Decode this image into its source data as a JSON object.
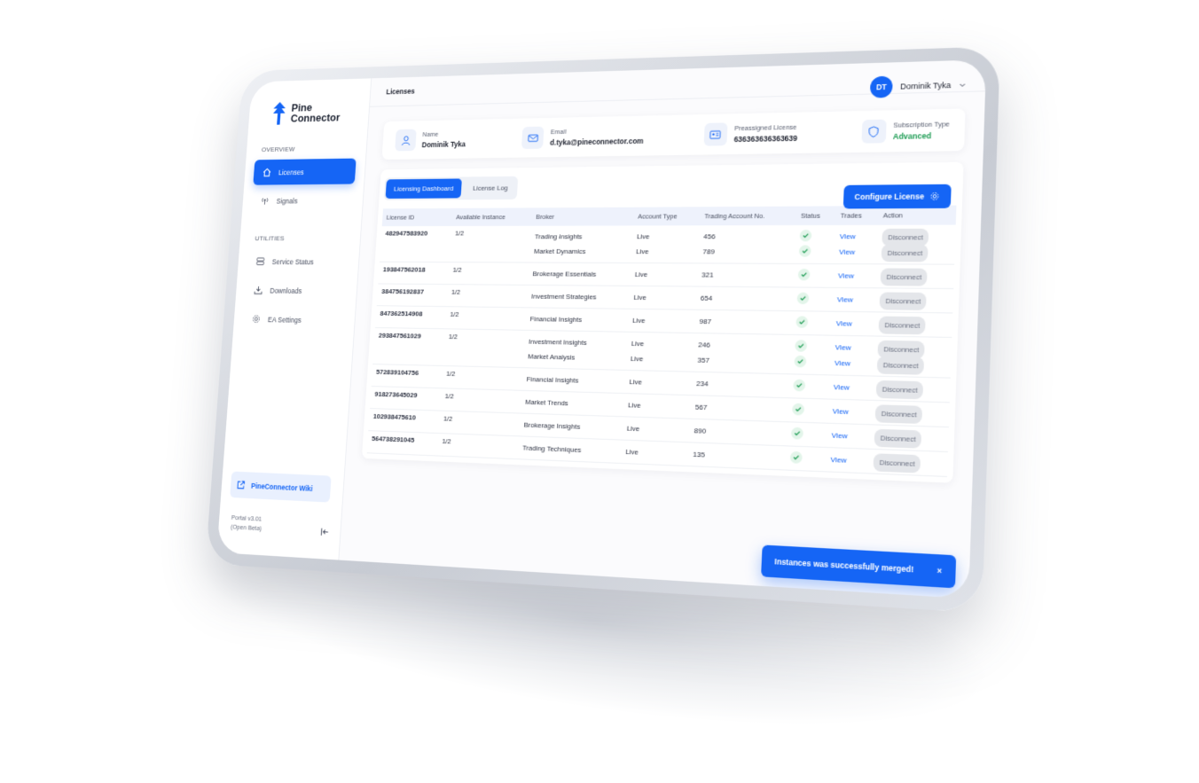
{
  "app": {
    "logo_line1": "Pine",
    "logo_line2": "Connector",
    "breadcrumb": "Licenses"
  },
  "sidebar": {
    "overview_label": "OVERVIEW",
    "utilities_label": "UTILITIES",
    "items": [
      {
        "label": "Licenses",
        "icon": "home-icon"
      },
      {
        "label": "Signals",
        "icon": "signal-icon"
      },
      {
        "label": "Service Status",
        "icon": "server-icon"
      },
      {
        "label": "Downloads",
        "icon": "download-icon"
      },
      {
        "label": "EA Settings",
        "icon": "gear-icon"
      }
    ],
    "wiki": "PineConnector Wiki",
    "version_line1": "Portal v3.01",
    "version_line2": "(Open Beta)"
  },
  "user": {
    "initials": "DT",
    "name": "Dominik Tyka"
  },
  "info": {
    "name_label": "Name",
    "name_value": "Dominik Tyka",
    "email_label": "Email",
    "email_value": "d.tyka@pineconnector.com",
    "license_label": "Preassigned License",
    "license_value": "636363636363639",
    "sub_label": "Subscription Type",
    "sub_value": "Advanced"
  },
  "tabs": {
    "dashboard": "Licensing Dashboard",
    "log": "License Log"
  },
  "configure_label": "Configure License",
  "table": {
    "headers": {
      "license_id": "License ID",
      "available": "Available Instance",
      "broker": "Broker",
      "account_type": "Account  Type",
      "account_no": "Trading  Account No.",
      "status": "Status",
      "trades": "Trades",
      "action": "Action"
    },
    "view_label": "View",
    "disconnect_label": "Disconnect",
    "rows": [
      {
        "id": "482947583920",
        "avail": "1/2",
        "sub": [
          {
            "broker": "Trading Insights",
            "type": "Live",
            "acc": "456"
          },
          {
            "broker": "Market Dynamics",
            "type": "Live",
            "acc": "789"
          }
        ]
      },
      {
        "id": "193847562018",
        "avail": "1/2",
        "sub": [
          {
            "broker": "Brokerage Essentials",
            "type": "Live",
            "acc": "321"
          }
        ]
      },
      {
        "id": "384756192837",
        "avail": "1/2",
        "sub": [
          {
            "broker": "Investment Strategies",
            "type": "Live",
            "acc": "654"
          }
        ]
      },
      {
        "id": "847362514908",
        "avail": "1/2",
        "sub": [
          {
            "broker": "Financial Insights",
            "type": "Live",
            "acc": "987"
          }
        ]
      },
      {
        "id": "293847561029",
        "avail": "1/2",
        "sub": [
          {
            "broker": "Investment Insights",
            "type": "Live",
            "acc": "246"
          },
          {
            "broker": "Market Analysis",
            "type": "Live",
            "acc": "357"
          }
        ]
      },
      {
        "id": "572839104756",
        "avail": "1/2",
        "sub": [
          {
            "broker": "Financial Insights",
            "type": "Live",
            "acc": "234"
          }
        ]
      },
      {
        "id": "918273645029",
        "avail": "1/2",
        "sub": [
          {
            "broker": "Market Trends",
            "type": "Live",
            "acc": "567"
          }
        ]
      },
      {
        "id": "102938475610",
        "avail": "1/2",
        "sub": [
          {
            "broker": "Brokerage Insights",
            "type": "Live",
            "acc": "890"
          }
        ]
      },
      {
        "id": "564738291045",
        "avail": "1/2",
        "sub": [
          {
            "broker": "Trading Techniques",
            "type": "Live",
            "acc": "135"
          }
        ]
      }
    ]
  },
  "toast": {
    "message": "Instances was successfully merged!",
    "close": "×"
  },
  "colors": {
    "accent": "#1565f5",
    "success": "#1f9d55"
  }
}
